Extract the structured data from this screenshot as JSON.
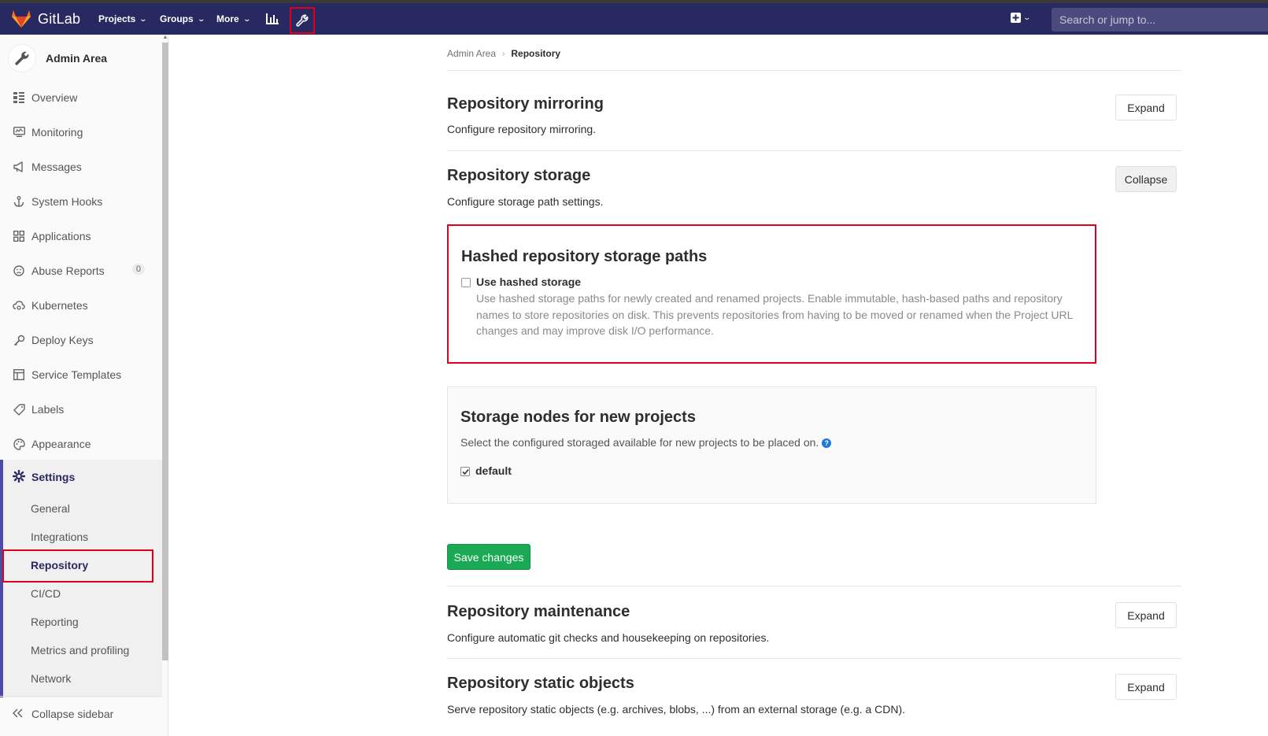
{
  "navbar": {
    "brand": "GitLab",
    "projects": "Projects",
    "groups": "Groups",
    "more": "More",
    "search_placeholder": "Search or jump to..."
  },
  "sidebar": {
    "title": "Admin Area",
    "items": [
      {
        "label": "Overview"
      },
      {
        "label": "Monitoring"
      },
      {
        "label": "Messages"
      },
      {
        "label": "System Hooks"
      },
      {
        "label": "Applications"
      },
      {
        "label": "Abuse Reports",
        "badge": "0"
      },
      {
        "label": "Kubernetes"
      },
      {
        "label": "Deploy Keys"
      },
      {
        "label": "Service Templates"
      },
      {
        "label": "Labels"
      },
      {
        "label": "Appearance"
      }
    ],
    "settings": {
      "label": "Settings",
      "sub": [
        "General",
        "Integrations",
        "Repository",
        "CI/CD",
        "Reporting",
        "Metrics and profiling",
        "Network"
      ],
      "active": "Repository"
    },
    "collapse": "Collapse sidebar"
  },
  "breadcrumb": {
    "parent": "Admin Area",
    "current": "Repository"
  },
  "sections": {
    "mirroring": {
      "title": "Repository mirroring",
      "desc": "Configure repository mirroring.",
      "button": "Expand"
    },
    "storage": {
      "title": "Repository storage",
      "desc": "Configure storage path settings.",
      "button": "Collapse"
    },
    "maintenance": {
      "title": "Repository maintenance",
      "desc": "Configure automatic git checks and housekeeping on repositories.",
      "button": "Expand"
    },
    "static": {
      "title": "Repository static objects",
      "desc": "Serve repository static objects (e.g. archives, blobs, ...) from an external storage (e.g. a CDN).",
      "button": "Expand"
    }
  },
  "hashed": {
    "title": "Hashed repository storage paths",
    "checkbox_label": "Use hashed storage",
    "checked": false,
    "help": "Use hashed storage paths for newly created and renamed projects. Enable immutable, hash-based paths and repository names to store repositories on disk. This prevents repositories from having to be moved or renamed when the Project URL changes and may improve disk I/O performance."
  },
  "nodes": {
    "title": "Storage nodes for new projects",
    "desc": "Select the configured storaged available for new projects to be placed on.",
    "checkbox_label": "default",
    "checked": true
  },
  "save_button": "Save changes",
  "colors": {
    "navbar": "#292961",
    "highlight": "#e0001a",
    "save": "#1aaa55"
  }
}
